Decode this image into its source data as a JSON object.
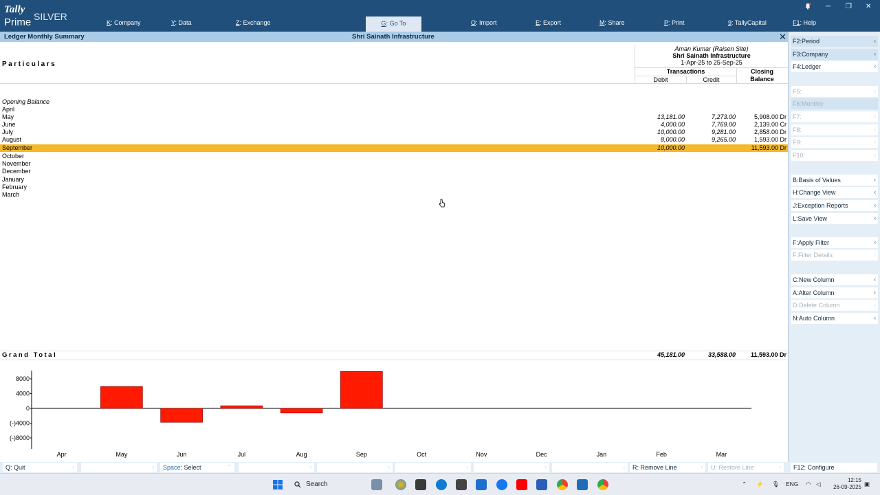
{
  "app": {
    "brand": "Tally",
    "edition": "SILVER",
    "product": "Prime"
  },
  "menu": [
    {
      "key": "K",
      "label": "Company"
    },
    {
      "key": "Y",
      "label": "Data"
    },
    {
      "key": "Z",
      "label": "Exchange"
    },
    {
      "key": "G",
      "label": "Go To"
    },
    {
      "key": "O",
      "label": "Import"
    },
    {
      "key": "E",
      "label": "Export"
    },
    {
      "key": "M",
      "label": "Share"
    },
    {
      "key": "P",
      "label": "Print"
    },
    {
      "key": "9",
      "label": "TallyCapital"
    },
    {
      "key": "F1",
      "label": "Help"
    }
  ],
  "report": {
    "title": "Ledger Monthly Summary",
    "company": "Shri Sainath Infrastructure",
    "close": "✕",
    "particulars_label": "Particulars",
    "ledger_name": "Aman Kumar (Raisen Site)",
    "company_name": "Shri Sainath Infrastructure",
    "period": "1-Apr-25 to 25-Sep-25",
    "transactions_label": "Transactions",
    "closing_label_1": "Closing",
    "closing_label_2": "Balance",
    "debit_label": "Debit",
    "credit_label": "Credit",
    "opening_label": "Opening Balance",
    "rows": [
      {
        "month": "April",
        "debit": "",
        "credit": "",
        "closing": ""
      },
      {
        "month": "May",
        "debit": "13,181.00",
        "credit": "7,273.00",
        "closing": "5,908.00 Dr"
      },
      {
        "month": "June",
        "debit": "4,000.00",
        "credit": "7,769.00",
        "closing": "2,139.00 Cr"
      },
      {
        "month": "July",
        "debit": "10,000.00",
        "credit": "9,281.00",
        "closing": "2,858.00 Dr"
      },
      {
        "month": "August",
        "debit": "8,000.00",
        "credit": "9,265.00",
        "closing": "1,593.00 Dr"
      },
      {
        "month": "September",
        "debit": "10,000.00",
        "credit": "",
        "closing": "11,593.00 Dr"
      },
      {
        "month": "October",
        "debit": "",
        "credit": "",
        "closing": ""
      },
      {
        "month": "November",
        "debit": "",
        "credit": "",
        "closing": ""
      },
      {
        "month": "December",
        "debit": "",
        "credit": "",
        "closing": ""
      },
      {
        "month": "January",
        "debit": "",
        "credit": "",
        "closing": ""
      },
      {
        "month": "February",
        "debit": "",
        "credit": "",
        "closing": ""
      },
      {
        "month": "March",
        "debit": "",
        "credit": "",
        "closing": ""
      }
    ],
    "selected_month": "September",
    "grand_total_label": "Grand Total",
    "grand_total": {
      "debit": "45,181.00",
      "credit": "33,588.00",
      "closing": "11,593.00 Dr"
    }
  },
  "chart_data": {
    "type": "bar",
    "categories": [
      "Apr",
      "May",
      "Jun",
      "Jul",
      "Aug",
      "Sep",
      "Oct",
      "Nov",
      "Dec",
      "Jan",
      "Feb",
      "Mar"
    ],
    "values": [
      0,
      5908,
      -3769,
      719,
      -1265,
      10000,
      0,
      0,
      0,
      0,
      0,
      0
    ],
    "yticks": [
      "8000",
      "4000",
      "0",
      "(-)4000",
      "(-)8000"
    ],
    "ylim": [
      -10000,
      10500
    ],
    "bar_color": "#ff1a00"
  },
  "right_panel": [
    {
      "key": "F2",
      "label": "Period",
      "enabled": true,
      "tint": true
    },
    {
      "key": "F3",
      "label": "Company",
      "enabled": true,
      "tint": true
    },
    {
      "key": "F4",
      "label": "Ledger",
      "enabled": true,
      "tint": false
    },
    {
      "key": "F5",
      "label": "",
      "enabled": false,
      "tint": false
    },
    {
      "key": "F6",
      "label": "Monthly",
      "enabled": false,
      "tint": true
    },
    {
      "key": "F7",
      "label": "",
      "enabled": false,
      "tint": false
    },
    {
      "key": "F8",
      "label": "",
      "enabled": false,
      "tint": false
    },
    {
      "key": "F9",
      "label": "",
      "enabled": false,
      "tint": false
    },
    {
      "key": "F10",
      "label": "",
      "enabled": false,
      "tint": false
    },
    {
      "key": "B",
      "label": "Basis of Values",
      "enabled": true,
      "tint": false
    },
    {
      "key": "H",
      "label": "Change View",
      "enabled": true,
      "tint": false
    },
    {
      "key": "J",
      "label": "Exception Reports",
      "enabled": true,
      "tint": false
    },
    {
      "key": "L",
      "label": "Save View",
      "enabled": true,
      "tint": false
    },
    {
      "key": "F",
      "label": "Apply Filter",
      "enabled": true,
      "tint": false
    },
    {
      "key": "F",
      "label": "Filter Details",
      "enabled": false,
      "tint": false
    },
    {
      "key": "C",
      "label": "New Column",
      "enabled": true,
      "tint": false
    },
    {
      "key": "A",
      "label": "Alter Column",
      "enabled": true,
      "tint": false
    },
    {
      "key": "D",
      "label": "Delete Column",
      "enabled": false,
      "tint": false
    },
    {
      "key": "N",
      "label": "Auto Column",
      "enabled": true,
      "tint": false
    }
  ],
  "bottom_bar": {
    "quit": {
      "key": "Q",
      "label": "Quit"
    },
    "select": {
      "key": "Space",
      "label": "Select"
    },
    "remove_line": {
      "key": "R",
      "label": "Remove Line"
    },
    "restore_line": {
      "key": "U",
      "label": "Restore Line"
    },
    "configure": {
      "key": "F12",
      "label": "Configure"
    }
  },
  "taskbar": {
    "search_label": "Search",
    "language": "ENG",
    "time": "12:15",
    "date": "26-09-2025"
  }
}
